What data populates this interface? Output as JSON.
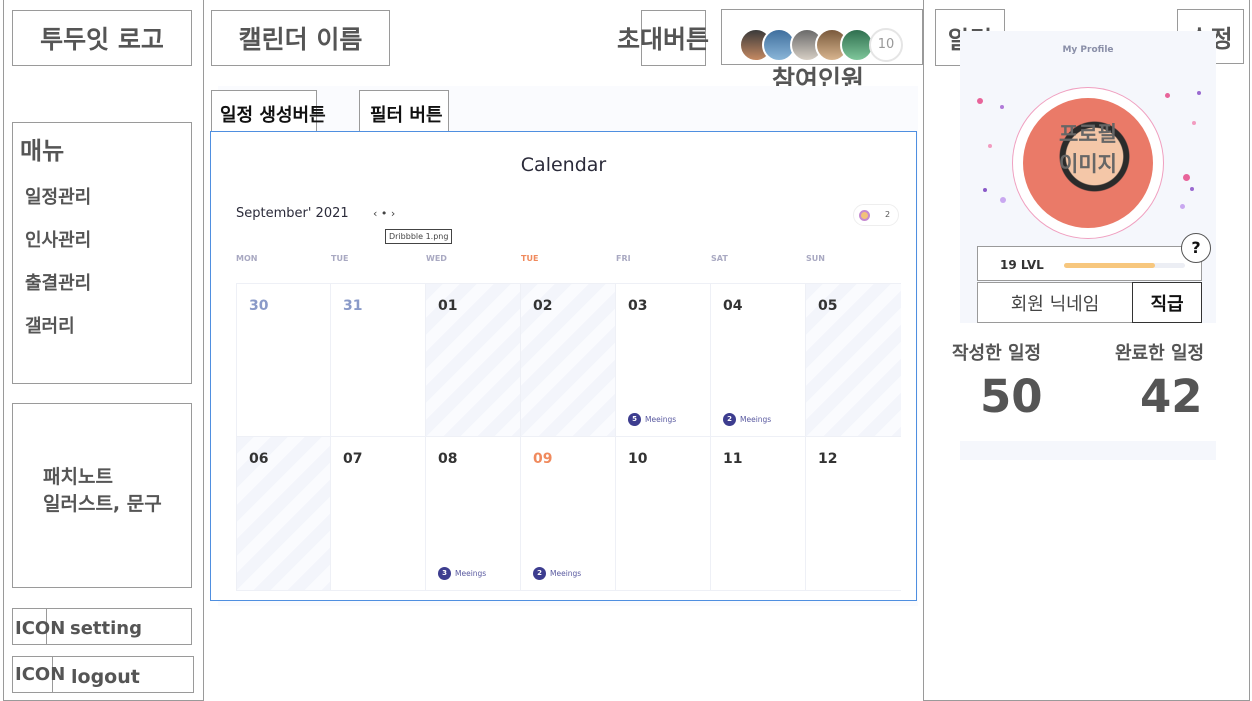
{
  "logo": "투두잇 로고",
  "calendar_name": "캘린더 이름",
  "invite_button": "초대버튼",
  "participants_label": "참여인원",
  "participant_count": "10",
  "notification": "알림",
  "edit": "수정",
  "menu": {
    "title": "매뉴",
    "items": [
      "일정관리",
      "인사관리",
      "출결관리",
      "갤러리"
    ]
  },
  "patch_note": "패치노트\n일러스트, 문구",
  "setting": {
    "icon": "ICON",
    "label": "setting"
  },
  "logout": {
    "icon": "ICON",
    "label": "logout"
  },
  "toolbar": {
    "create": "일정 생성버튼",
    "filter": "필터 버튼"
  },
  "calendar": {
    "title": "Calendar",
    "month": "September' 2021",
    "nav": "‹  •  ›",
    "tooltip": "Dribbble 1.png",
    "badge_count": "2",
    "weekdays": [
      "MON",
      "TUE",
      "WED",
      "TUE",
      "FRI",
      "SAT",
      "SUN"
    ],
    "row1": [
      "30",
      "31",
      "01",
      "02",
      "03",
      "04",
      "05"
    ],
    "row2": [
      "06",
      "07",
      "08",
      "09",
      "10",
      "11",
      "12"
    ],
    "meetings": [
      {
        "count": "5",
        "label": "Meeings"
      },
      {
        "count": "2",
        "label": "Meeings"
      },
      {
        "count": "3",
        "label": "Meeings"
      },
      {
        "count": "2",
        "label": "Meeings"
      }
    ]
  },
  "profile": {
    "header": "My Profile",
    "image_label": "프로필\n이미지",
    "help": "?",
    "level": "19 LVL",
    "level_progress": 0.75,
    "nickname": "회원 닉네임",
    "rank": "직급"
  },
  "stats": {
    "created_label": "작성한 일정",
    "created_value": "50",
    "completed_label": "완료한 일정",
    "completed_value": "42"
  },
  "colors": {
    "accent": "#4f8fe0",
    "meeting": "#3d3d8f",
    "weekday_highlight": "#f08a5d",
    "level_bar": "#f7c77e"
  }
}
